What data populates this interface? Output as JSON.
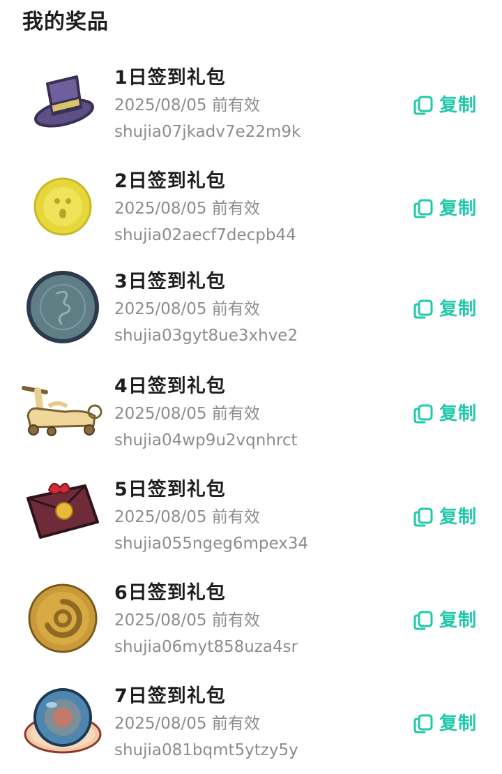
{
  "page": {
    "title": "我的奖品"
  },
  "theme": {
    "accent": "#1fc9a9",
    "text_primary": "#1e1e1e",
    "text_secondary": "#8c8c8c"
  },
  "prizes": [
    {
      "name": "1日签到礼包",
      "expiry": "2025/08/05 前有效",
      "code": "shujia07jkadv7e22m9k",
      "icon": "top-hat-icon",
      "copy_label": "复制",
      "copy_icon": "copy-icon"
    },
    {
      "name": "2日签到礼包",
      "expiry": "2025/08/05 前有效",
      "code": "shujia02aecf7decpb44",
      "icon": "yellow-coin-icon",
      "copy_label": "复制",
      "copy_icon": "copy-icon"
    },
    {
      "name": "3日签到礼包",
      "expiry": "2025/08/05 前有效",
      "code": "shujia03gyt8ue3xhve2",
      "icon": "gray-coin-icon",
      "copy_label": "复制",
      "copy_icon": "copy-icon"
    },
    {
      "name": "4日签到礼包",
      "expiry": "2025/08/05 前有效",
      "code": "shujia04wp9u2vqnhrct",
      "icon": "scooter-icon",
      "copy_label": "复制",
      "copy_icon": "copy-icon"
    },
    {
      "name": "5日签到礼包",
      "expiry": "2025/08/05 前有效",
      "code": "shujia055ngeg6mpex34",
      "icon": "red-envelope-icon",
      "copy_label": "复制",
      "copy_icon": "copy-icon"
    },
    {
      "name": "6日签到礼包",
      "expiry": "2025/08/05 前有效",
      "code": "shujia06myt858uza4sr",
      "icon": "gold-coin-icon",
      "copy_label": "复制",
      "copy_icon": "copy-icon"
    },
    {
      "name": "7日签到礼包",
      "expiry": "2025/08/05 前有效",
      "code": "shujia081bqmt5ytzy5y",
      "icon": "crystal-ball-icon",
      "copy_label": "复制",
      "copy_icon": "copy-icon"
    }
  ]
}
